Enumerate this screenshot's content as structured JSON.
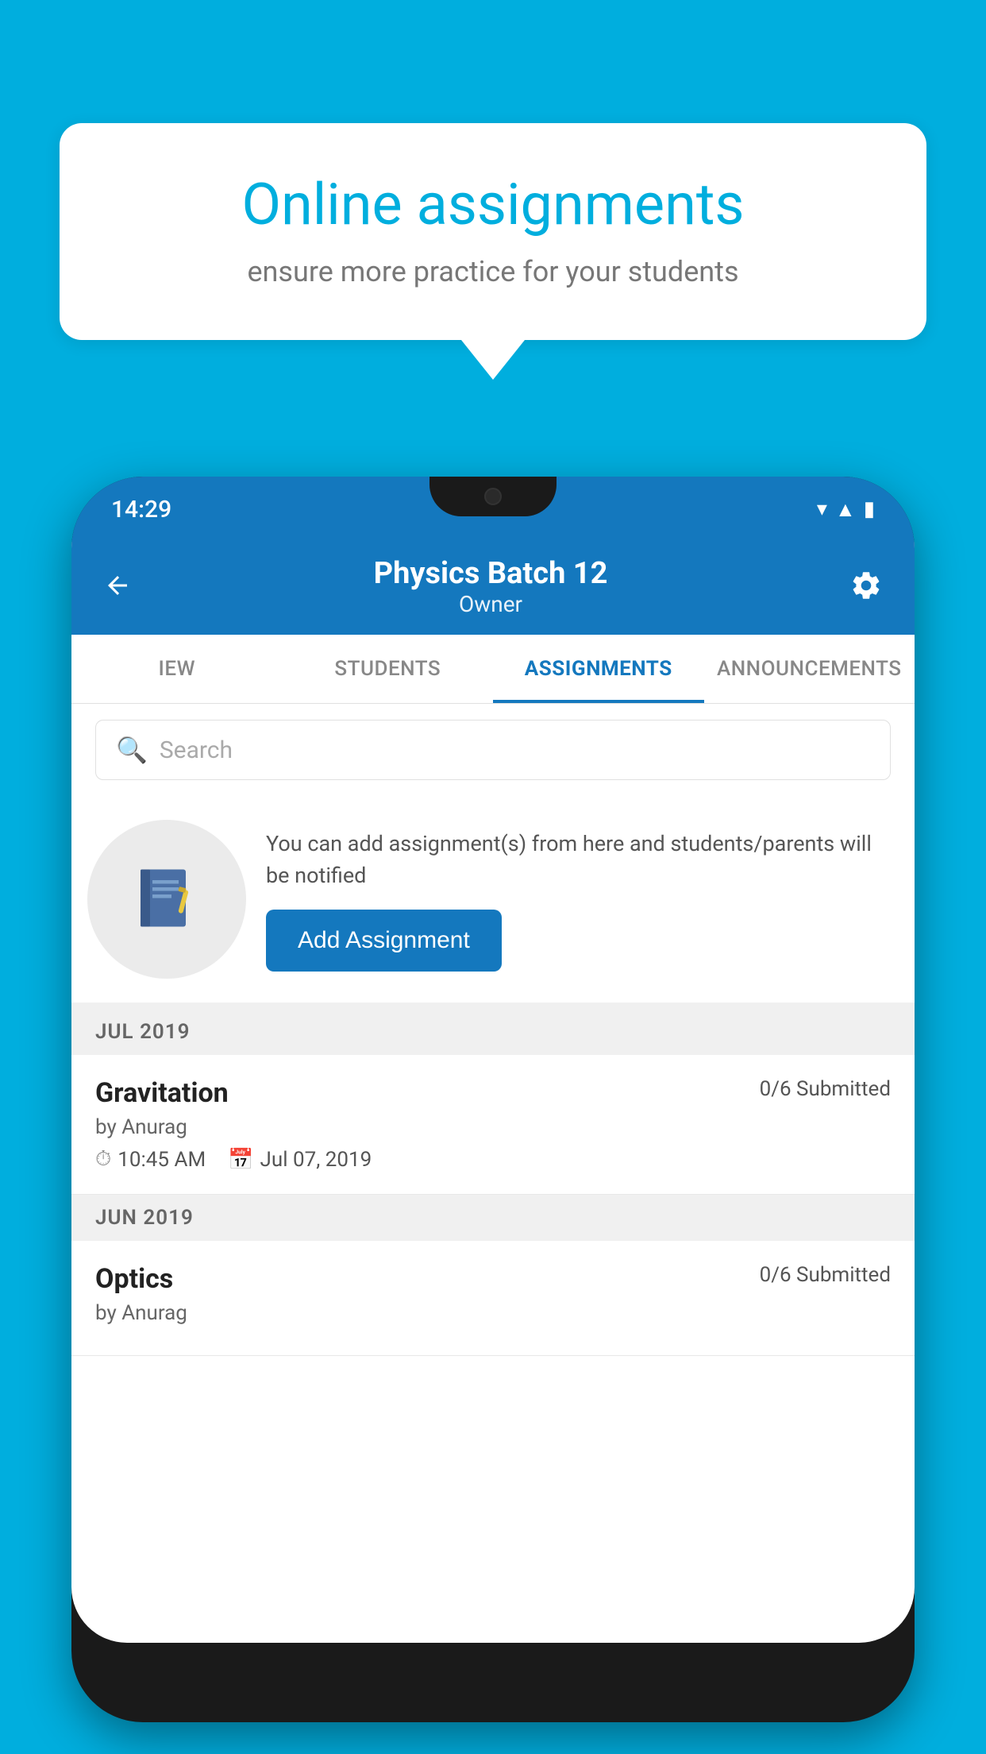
{
  "background_color": "#00AEDE",
  "speech_bubble": {
    "title": "Online assignments",
    "subtitle": "ensure more practice for your students"
  },
  "phone": {
    "time": "14:29",
    "header": {
      "title": "Physics Batch 12",
      "subtitle": "Owner",
      "back_label": "←",
      "settings_label": "⚙"
    },
    "tabs": [
      {
        "label": "IEW",
        "active": false
      },
      {
        "label": "STUDENTS",
        "active": false
      },
      {
        "label": "ASSIGNMENTS",
        "active": true
      },
      {
        "label": "ANNOUNCEMENTS",
        "active": false
      }
    ],
    "search": {
      "placeholder": "Search"
    },
    "promo": {
      "text": "You can add assignment(s) from here and students/parents will be notified",
      "button_label": "Add Assignment"
    },
    "sections": [
      {
        "month_label": "JUL 2019",
        "assignments": [
          {
            "name": "Gravitation",
            "submitted": "0/6 Submitted",
            "by": "by Anurag",
            "time": "10:45 AM",
            "date": "Jul 07, 2019"
          }
        ]
      },
      {
        "month_label": "JUN 2019",
        "assignments": [
          {
            "name": "Optics",
            "submitted": "0/6 Submitted",
            "by": "by Anurag",
            "time": "",
            "date": ""
          }
        ]
      }
    ]
  }
}
